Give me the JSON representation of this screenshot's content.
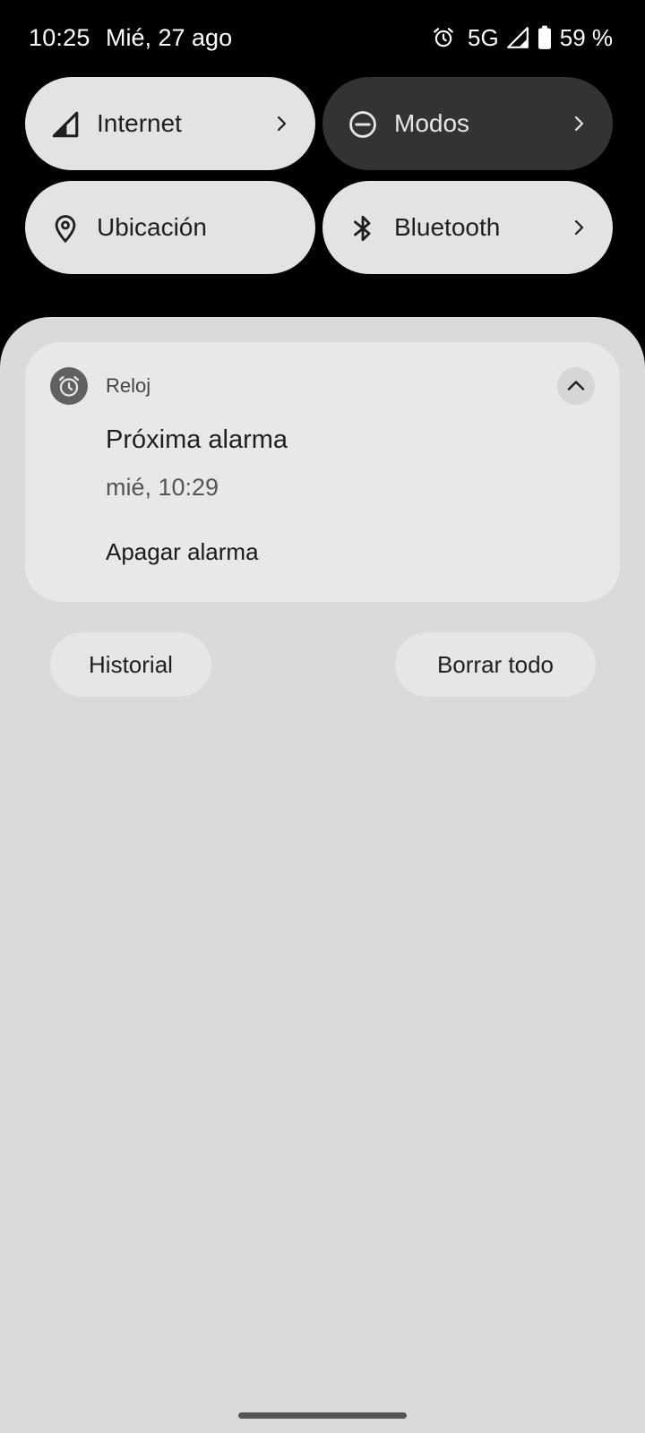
{
  "status_bar": {
    "time": "10:25",
    "date": "Mié, 27 ago",
    "network": "5G",
    "battery": "59 %",
    "icons": [
      "alarm-icon",
      "signal-icon",
      "battery-icon"
    ]
  },
  "quick_settings": {
    "internet": {
      "label": "Internet",
      "icon": "signal-icon"
    },
    "modes": {
      "label": "Modos",
      "icon": "do-not-disturb-icon",
      "active": true
    },
    "location": {
      "label": "Ubicación",
      "icon": "location-pin-icon"
    },
    "bluetooth": {
      "label": "Bluetooth",
      "icon": "bluetooth-icon"
    }
  },
  "notification": {
    "app_name": "Reloj",
    "app_icon": "alarm-clock-icon",
    "title": "Próxima alarma",
    "text": "mié, 10:29",
    "action": "Apagar alarma"
  },
  "footer": {
    "history_label": "Historial",
    "clear_all_label": "Borrar todo"
  },
  "colors": {
    "background": "#000000",
    "tile_light": "#e3e3e3",
    "tile_dark": "#333333",
    "sheet": "#dadada",
    "card": "#e8e8e8"
  }
}
